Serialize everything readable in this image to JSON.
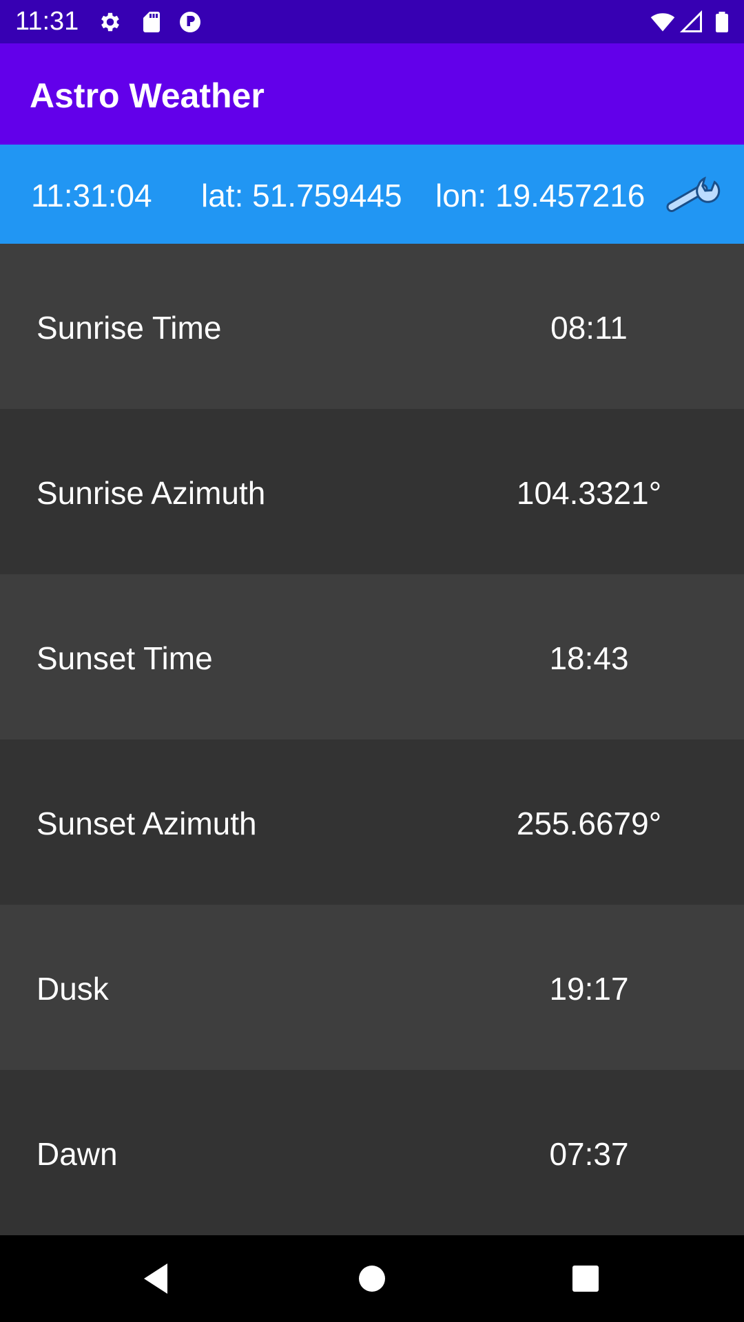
{
  "status_bar": {
    "time": "11:31",
    "icons": [
      "gear-icon",
      "sd-card-icon",
      "vpn-icon",
      "wifi-icon",
      "signal-icon",
      "battery-icon"
    ]
  },
  "app_bar": {
    "title": "Astro Weather"
  },
  "info_bar": {
    "clock": "11:31:04",
    "latitude": "lat: 51.759445",
    "longitude": "lon: 19.457216",
    "settings_icon": "wrench-icon"
  },
  "rows": [
    {
      "label": "Sunrise Time",
      "value": "08:11"
    },
    {
      "label": "Sunrise Azimuth",
      "value": "104.3321°"
    },
    {
      "label": "Sunset Time",
      "value": "18:43"
    },
    {
      "label": "Sunset Azimuth",
      "value": "255.6679°"
    },
    {
      "label": "Dusk",
      "value": "19:17"
    },
    {
      "label": "Dawn",
      "value": "07:37"
    }
  ],
  "nav_bar": {
    "icons": [
      "back-icon",
      "home-icon",
      "recents-icon"
    ]
  },
  "colors": {
    "status_bar": "#3700b3",
    "app_bar": "#6200ea",
    "info_bar": "#2196f3",
    "row_light": "#3e3e3e",
    "row_dark": "#333333"
  }
}
